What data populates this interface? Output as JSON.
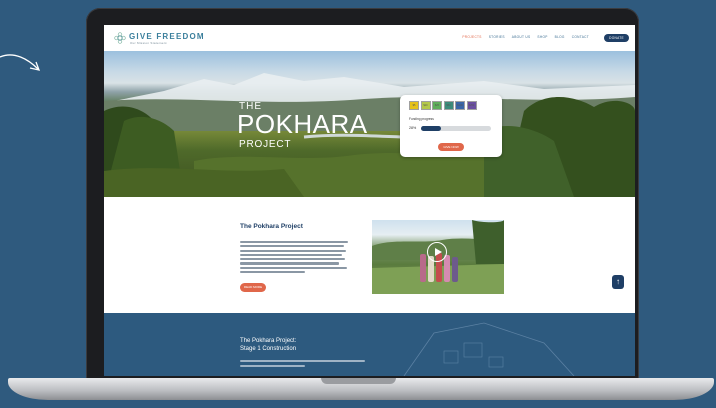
{
  "site": {
    "logo_text": "GIVE FREEDOM",
    "logo_subtitle": "Our Mission Statement",
    "nav_items": [
      {
        "label": "PROJECTS",
        "active": true
      },
      {
        "label": "STORIES",
        "active": false
      },
      {
        "label": "ABOUT US",
        "active": false
      },
      {
        "label": "SHOP",
        "active": false
      },
      {
        "label": "BLOG",
        "active": false
      },
      {
        "label": "CONTACT",
        "active": false
      }
    ],
    "nav_cta_label": "DONATE",
    "hero": {
      "title_prefix": "THE",
      "title": "POKHARA",
      "title_suffix": "PROJECT"
    },
    "donate_card": {
      "chips": [
        "$5",
        "$10",
        "$25",
        "$50",
        "$100",
        "$250"
      ],
      "chip_colors": [
        "#e5c21b",
        "#b4c84a",
        "#5fae5a",
        "#3c8b7a",
        "#3a66a8",
        "#6a4fa0"
      ],
      "funding_label": "Funding progress",
      "progress_percent": 28,
      "progress_label": "28%",
      "button_label": "GIVE NOW"
    },
    "about": {
      "title": "The Pokhara Project",
      "button_label": "READ MORE"
    },
    "stage": {
      "title_line1": "The Pokhara Project:",
      "title_line2": "Stage 1 Construction"
    },
    "colors": {
      "accent": "#e0674a",
      "navy": "#1f3f66",
      "background": "#2f5a7e"
    }
  }
}
